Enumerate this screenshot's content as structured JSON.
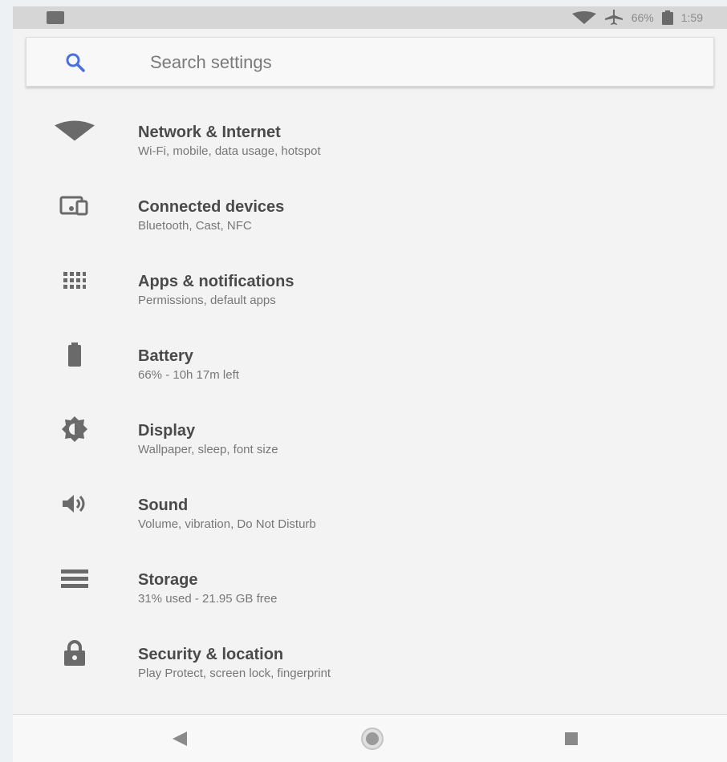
{
  "status_bar": {
    "battery_percent": "66%",
    "time": "1:59"
  },
  "search": {
    "placeholder": "Search settings"
  },
  "settings_items": [
    {
      "title": "Network & Internet",
      "subtitle": "Wi-Fi, mobile, data usage, hotspot",
      "icon": "wifi-icon"
    },
    {
      "title": "Connected devices",
      "subtitle": "Bluetooth, Cast, NFC",
      "icon": "devices-icon"
    },
    {
      "title": "Apps & notifications",
      "subtitle": "Permissions, default apps",
      "icon": "apps-grid-icon"
    },
    {
      "title": "Battery",
      "subtitle": "66% - 10h 17m left",
      "icon": "battery-icon"
    },
    {
      "title": "Display",
      "subtitle": "Wallpaper, sleep, font size",
      "icon": "brightness-icon"
    },
    {
      "title": "Sound",
      "subtitle": "Volume, vibration, Do Not Disturb",
      "icon": "volume-icon"
    },
    {
      "title": "Storage",
      "subtitle": "31% used - 21.95 GB free",
      "icon": "storage-icon"
    },
    {
      "title": "Security & location",
      "subtitle": "Play Protect, screen lock, fingerprint",
      "icon": "lock-icon"
    }
  ],
  "colors": {
    "accent": "#4a6fe0",
    "icon": "#6a6a6a",
    "background": "#f3f3f3"
  }
}
